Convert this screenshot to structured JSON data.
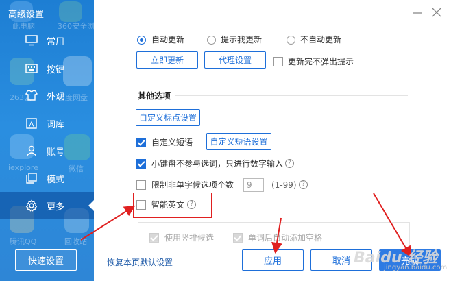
{
  "window": {
    "title": "高级设置"
  },
  "background_desktop": {
    "labels": [
      "此电脑",
      "360安全浏",
      "263云",
      "百度网盘",
      "iexplore",
      "微信",
      "腾讯QQ",
      "回收站"
    ]
  },
  "sidebar": {
    "items": [
      {
        "label": "常用",
        "icon": "monitor-icon"
      },
      {
        "label": "按键",
        "icon": "keyboard-icon"
      },
      {
        "label": "外观",
        "icon": "shirt-icon"
      },
      {
        "label": "词库",
        "icon": "dictionary-icon"
      },
      {
        "label": "账号",
        "icon": "user-icon"
      },
      {
        "label": "模式",
        "icon": "mode-icon"
      },
      {
        "label": "更多",
        "icon": "gear-icon",
        "active": true
      }
    ],
    "quick_settings_label": "快速设置"
  },
  "update": {
    "options": [
      {
        "label": "自动更新",
        "selected": true
      },
      {
        "label": "提示我更新",
        "selected": false
      },
      {
        "label": "不自动更新",
        "selected": false
      }
    ],
    "update_now_label": "立即更新",
    "proxy_label": "代理设置",
    "no_popup_label": "更新完不弹出提示",
    "no_popup_checked": false
  },
  "other_options": {
    "section_title": "其他选项",
    "custom_punct_label": "自定义标点设置",
    "custom_phrase_label": "自定义短语",
    "custom_phrase_checked": true,
    "custom_phrase_settings_label": "自定义短语设置",
    "numpad_label": "小键盘不参与选词，只进行数字输入",
    "numpad_checked": true,
    "limit_label": "限制非单字候选项个数",
    "limit_checked": false,
    "limit_value": "9",
    "limit_range": "(1-99)",
    "smart_english_label": "智能英文",
    "smart_english_checked": false,
    "sub_options": [
      {
        "label": "使用竖排候选",
        "checked": true
      },
      {
        "label": "单词后自动添加空格",
        "checked": true
      }
    ]
  },
  "footer": {
    "reset_label": "恢复本页默认设置",
    "apply_label": "应用",
    "cancel_label": "取消",
    "done_label": "完成"
  },
  "watermark": {
    "text": "Baidu 经验",
    "url": "jingyan.baidu.com"
  },
  "colors": {
    "sidebar": "#2a8ee0",
    "accent": "#1e6fd9",
    "annotation": "#e02020"
  }
}
